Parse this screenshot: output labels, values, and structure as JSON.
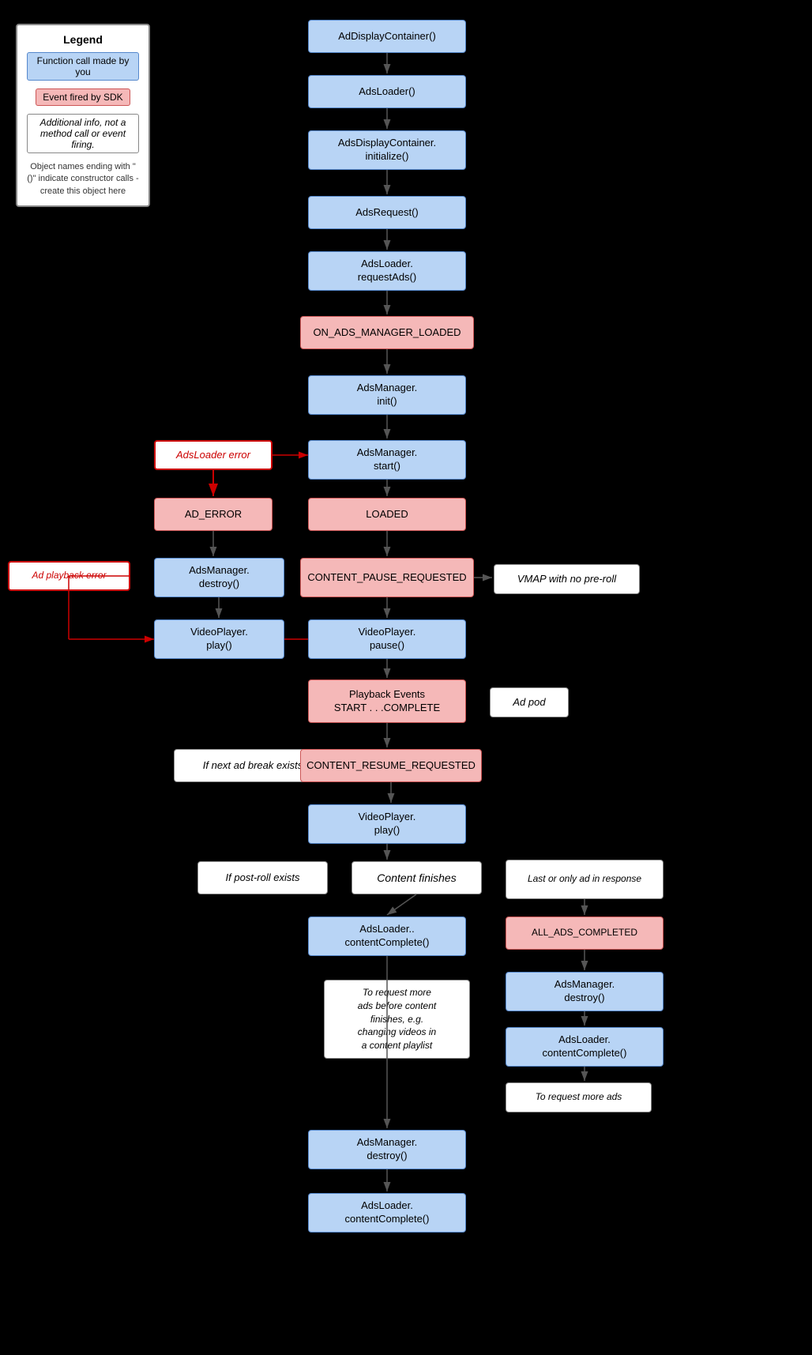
{
  "legend": {
    "title": "Legend",
    "blue_label": "Function call made by you",
    "pink_label": "Event fired by SDK",
    "italic_label": "Additional info, not a method call or event firing.",
    "note": "Object names ending with \"()\" indicate constructor calls - create this object here"
  },
  "boxes": {
    "ad_display_container": "AdDisplayContainer()",
    "ads_loader": "AdsLoader()",
    "ads_display_container_init": "AdsDisplayContainer.\ninitialize()",
    "ads_request": "AdsRequest()",
    "ads_loader_request_ads": "AdsLoader.\nrequestAds()",
    "on_ads_manager_loaded": "ON_ADS_MANAGER_LOADED",
    "ads_manager_init": "AdsManager.\ninit()",
    "ads_loader_error": "AdsLoader error",
    "ads_manager_start": "AdsManager.\nstart()",
    "ad_error": "AD_ERROR",
    "loaded": "LOADED",
    "ad_playback_error": "Ad playback error",
    "ads_manager_destroy1": "AdsManager.\ndestroy()",
    "content_pause_requested": "CONTENT_PAUSE_REQUESTED",
    "vmap_no_preroll": "VMAP with no pre-roll",
    "video_player_play1": "VideoPlayer.\nplay()",
    "video_player_pause": "VideoPlayer.\npause()",
    "playback_events": "Playback Events\nSTART . . .COMPLETE",
    "ad_pod": "Ad pod",
    "if_next_ad_break": "If next ad break exists",
    "content_resume_requested": "CONTENT_RESUME_REQUESTED",
    "video_player_play2": "VideoPlayer.\nplay()",
    "if_post_roll": "If post-roll exists",
    "content_finishes": "Content finishes",
    "last_only_ad": "Last or only ad in response",
    "all_ads_completed": "ALL_ADS_COMPLETED",
    "ads_loader_content_complete1": "AdsLoader..\ncontentComplete()",
    "ads_manager_destroy2": "AdsManager.\ndestroy()",
    "ads_loader_content_complete2": "AdsLoader.\ncontentComplete()",
    "to_request_more_ads_note": "To request more\nads before content\nfinishes, e.g.\nchanging videos in\na content playlist",
    "to_request_more_ads": "To request more ads",
    "ads_manager_destroy3": "AdsManager.\ndestroy()",
    "ads_loader_content_complete3": "AdsLoader.\ncontentComplete()"
  }
}
